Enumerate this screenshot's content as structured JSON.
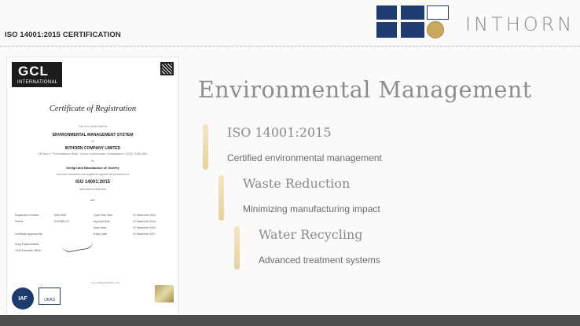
{
  "header": {
    "section_label": "ISO 14001:2015 CERTIFICATION",
    "brand": "INTHORN"
  },
  "certificate": {
    "logo_main": "GCL",
    "logo_sub": "INTERNATIONAL",
    "title": "Certificate of Registration",
    "intro": "This is to certify that the",
    "system": "ENVIRONMENTAL MANAGEMENT SYSTEM",
    "of": "of",
    "company": "INTHORN COMPANY LIMITED",
    "address": "433 Moo 2, Phetchakasem Road, Omnoi, Krathumbaen, Samutsakhon 74130, THAILAND",
    "for": "for",
    "scope": "Design and Manufacture of Jewelry",
    "assessed": "has been assessed and registered against the provisions of",
    "standard": "ISO 14001:2015",
    "standard_sub": "International Standard",
    "with": "with",
    "rows": [
      [
        "Registration Number:",
        "E/BO2936",
        "Cycle Start Date:",
        "24 September 2024"
      ],
      [
        "Period:",
        "E4/2/999-1-E",
        "Approval Date:",
        "24 September 2024"
      ],
      [
        "",
        "",
        "Issue Date:",
        "24 September 2024"
      ],
      [
        "Certificate Approved By:",
        "",
        "Expiry Date:",
        "24 September 2027"
      ]
    ],
    "signer": "Doug Papamichaelis",
    "signer_title": "Chief Executive Officer",
    "footer": "GCL INTERNATIONAL LTD",
    "badges": [
      "IAF",
      "UKAS"
    ]
  },
  "main": {
    "title": "Environmental Management",
    "items": [
      {
        "title": "ISO 14001:2015",
        "desc": "Certified environmental management"
      },
      {
        "title": "Waste Reduction",
        "desc": "Minimizing manufacturing impact"
      },
      {
        "title": "Water Recycling",
        "desc": "Advanced treatment systems"
      }
    ]
  }
}
